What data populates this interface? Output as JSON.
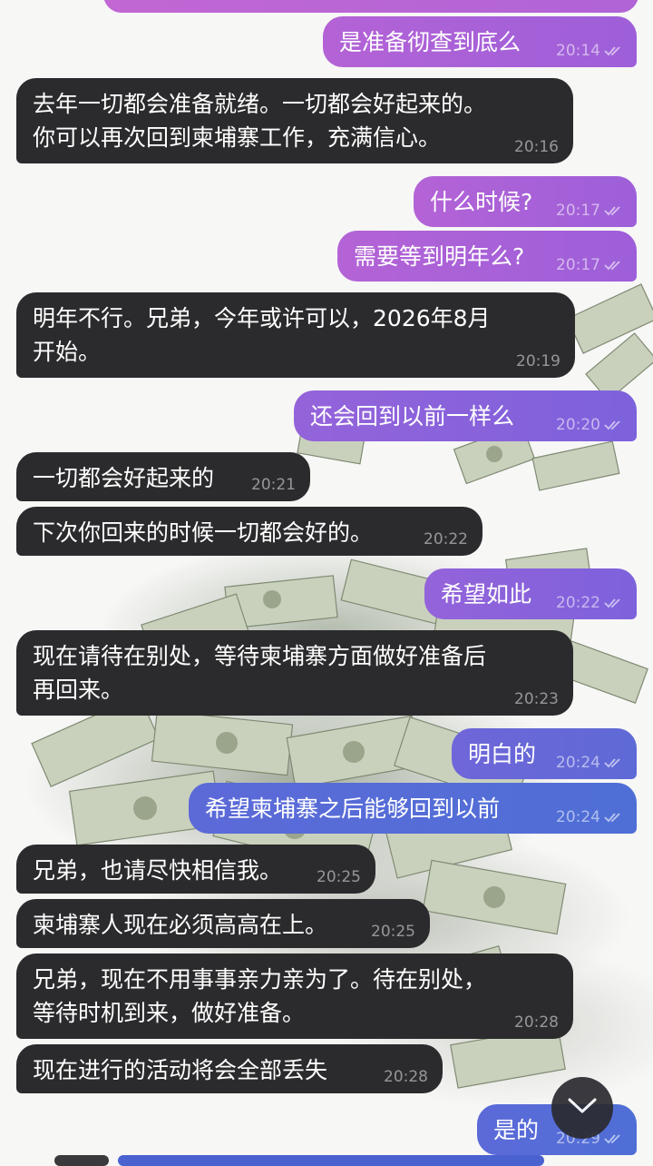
{
  "messages": [
    {
      "dir": "out",
      "text": "是准备彻查到底么",
      "time": "20:14"
    },
    {
      "dir": "in",
      "text": "去年一切都会准备就绪。一切都会好起来的。\n你可以再次回到柬埔寨工作，充满信心。",
      "time": "20:16"
    },
    {
      "dir": "out",
      "text": "什么时候?",
      "time": "20:17"
    },
    {
      "dir": "out",
      "text": "需要等到明年么?",
      "time": "20:17"
    },
    {
      "dir": "in",
      "text": "明年不行。兄弟，今年或许可以，2026年8月\n开始。",
      "time": "20:19"
    },
    {
      "dir": "out",
      "text": "还会回到以前一样么",
      "time": "20:20"
    },
    {
      "dir": "in",
      "text": "一切都会好起来的",
      "time": "20:21"
    },
    {
      "dir": "in",
      "text": "下次你回来的时候一切都会好的。",
      "time": "20:22"
    },
    {
      "dir": "out",
      "text": "希望如此",
      "time": "20:22"
    },
    {
      "dir": "in",
      "text": "现在请待在别处，等待柬埔寨方面做好准备后\n再回来。",
      "time": "20:23"
    },
    {
      "dir": "out",
      "text": "明白的",
      "time": "20:24"
    },
    {
      "dir": "out",
      "text": "希望柬埔寨之后能够回到以前",
      "time": "20:24"
    },
    {
      "dir": "in",
      "text": "兄弟，也请尽快相信我。",
      "time": "20:25"
    },
    {
      "dir": "in",
      "text": "柬埔寨人现在必须高高在上。",
      "time": "20:25"
    },
    {
      "dir": "in",
      "text": "兄弟，现在不用事事亲力亲为了。待在别处，\n等待时机到来，做好准备。",
      "time": "20:28"
    },
    {
      "dir": "in",
      "text": "现在进行的活动将会全部丢失",
      "time": "20:28"
    },
    {
      "dir": "out",
      "text": "是的",
      "time": "20:29"
    }
  ],
  "colors": {
    "incoming_bubble": "#2b2b2d",
    "outgoing_top": "#b463d6",
    "outgoing_bottom": "#4f6fd6"
  },
  "icons": {
    "read_receipt": "double-check-icon",
    "scroll_button": "chevron-down-icon"
  }
}
